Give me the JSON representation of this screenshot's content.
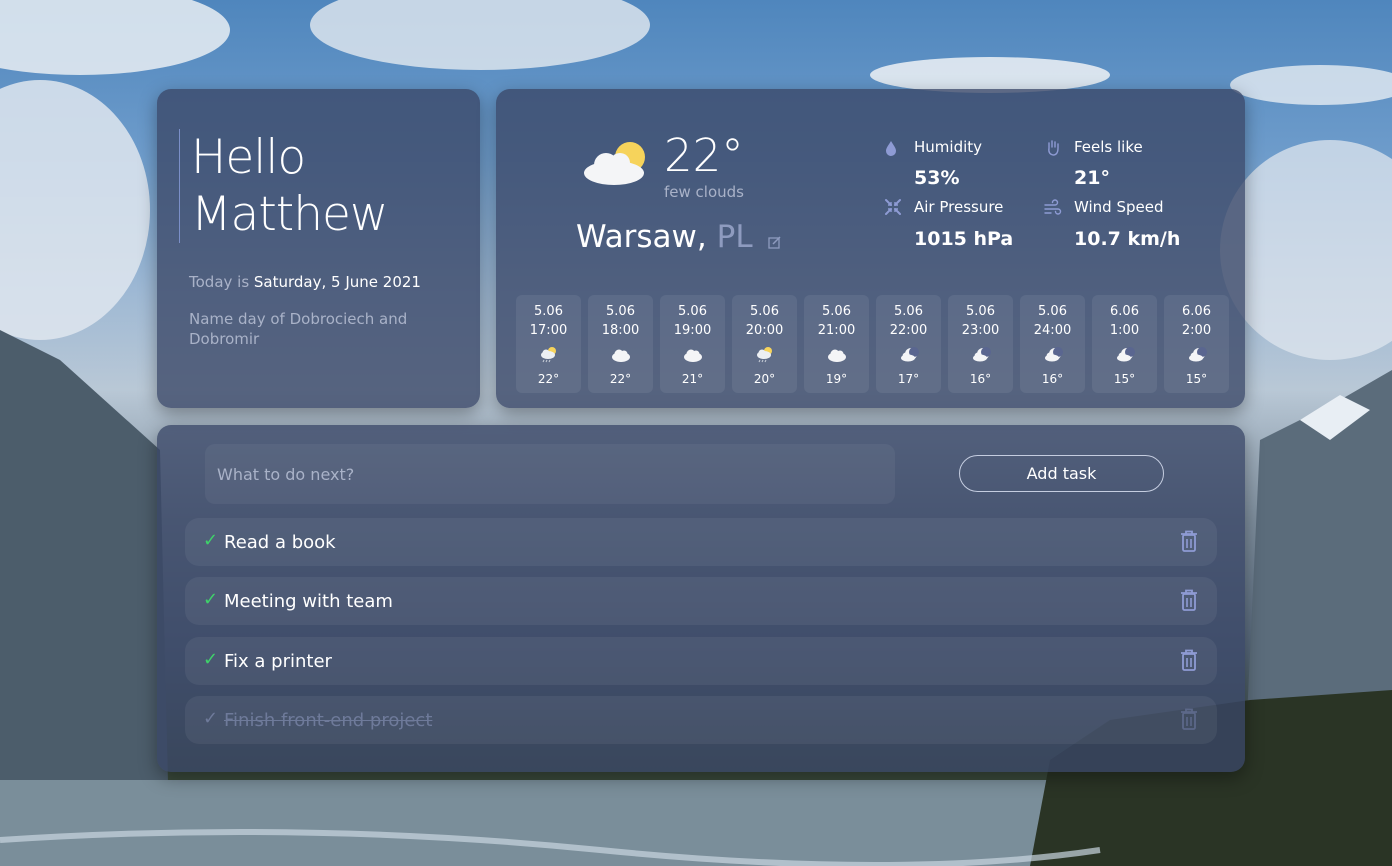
{
  "greeting": {
    "hello_line": "Hello",
    "name_line": "Matthew",
    "today_prefix": "Today is ",
    "date": "Saturday, 5 June 2021",
    "nameday": "Name day of Dobrociech and Dobromir"
  },
  "weather": {
    "icon": "few-clouds-icon",
    "temperature": "22°",
    "description": "few clouds",
    "city": "Warsaw,",
    "country": "PL",
    "stats": {
      "humidity_label": "Humidity",
      "humidity_value": "53%",
      "feels_label": "Feels like",
      "feels_value": "21°",
      "pressure_label": "Air Pressure",
      "pressure_value": "1015 hPa",
      "wind_label": "Wind Speed",
      "wind_value": "10.7 km/h"
    },
    "forecast": [
      {
        "date": "5.06",
        "time": "17:00",
        "icon": "sun-rain-icon",
        "temp": "22°"
      },
      {
        "date": "5.06",
        "time": "18:00",
        "icon": "cloud-icon",
        "temp": "22°"
      },
      {
        "date": "5.06",
        "time": "19:00",
        "icon": "cloud-icon",
        "temp": "21°"
      },
      {
        "date": "5.06",
        "time": "20:00",
        "icon": "sun-rain-icon",
        "temp": "20°"
      },
      {
        "date": "5.06",
        "time": "21:00",
        "icon": "cloud-icon",
        "temp": "19°"
      },
      {
        "date": "5.06",
        "time": "22:00",
        "icon": "moon-cloud-icon",
        "temp": "17°"
      },
      {
        "date": "5.06",
        "time": "23:00",
        "icon": "moon-cloud-icon",
        "temp": "16°"
      },
      {
        "date": "5.06",
        "time": "24:00",
        "icon": "moon-cloud-icon",
        "temp": "16°"
      },
      {
        "date": "6.06",
        "time": "1:00",
        "icon": "moon-cloud-icon",
        "temp": "15°"
      },
      {
        "date": "6.06",
        "time": "2:00",
        "icon": "moon-cloud-icon",
        "temp": "15°"
      }
    ]
  },
  "todo": {
    "input_placeholder": "What to do next?",
    "add_label": "Add task",
    "check_glyph": "✓",
    "tasks": [
      {
        "label": "Read a book",
        "done": false
      },
      {
        "label": "Meeting with team",
        "done": false
      },
      {
        "label": "Fix a printer",
        "done": false
      },
      {
        "label": "Finish front-end project",
        "done": true
      }
    ]
  },
  "colors": {
    "check": "#3fd16a",
    "card": "#3a4666",
    "accent": "#7b8fc8"
  }
}
